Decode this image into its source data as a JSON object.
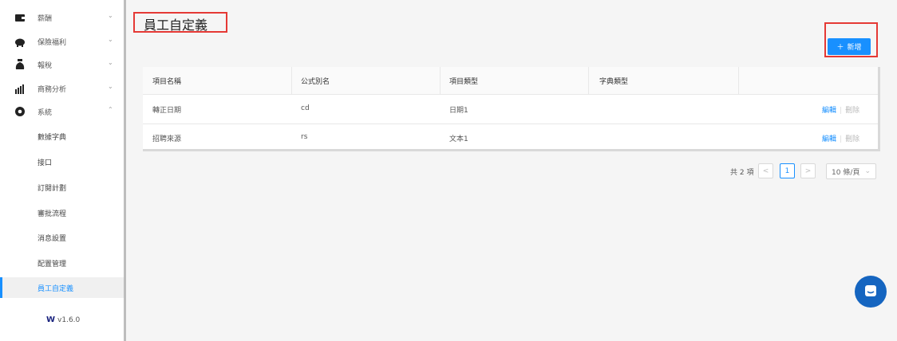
{
  "sidebar": {
    "items": [
      {
        "label": "薪酬",
        "icon": "wallet-icon",
        "chevron": "⌄"
      },
      {
        "label": "保險福利",
        "icon": "piggy-bank-icon",
        "chevron": "⌄"
      },
      {
        "label": "報稅",
        "icon": "money-bag-icon",
        "chevron": "⌄"
      },
      {
        "label": "商務分析",
        "icon": "bar-chart-icon",
        "chevron": "⌄"
      },
      {
        "label": "系統",
        "icon": "gear-icon",
        "chevron": "⌃"
      }
    ],
    "subitems": [
      {
        "label": "數據字典"
      },
      {
        "label": "接口"
      },
      {
        "label": "訂閱計劃"
      },
      {
        "label": "審批流程"
      },
      {
        "label": "消息設置"
      },
      {
        "label": "配置管理"
      },
      {
        "label": "員工自定義"
      }
    ],
    "version": "v1.6.0"
  },
  "page": {
    "title": "員工自定義",
    "add_button": "新增"
  },
  "table": {
    "headers": [
      "項目名稱",
      "公式別名",
      "項目類型",
      "字典類型"
    ],
    "rows": [
      {
        "name": "轉正日期",
        "alias": "cd",
        "type": "日期1",
        "dict": "",
        "edit": "編輯",
        "delete": "刪除"
      },
      {
        "name": "招聘來源",
        "alias": "rs",
        "type": "文本1",
        "dict": "",
        "edit": "編輯",
        "delete": "刪除"
      }
    ]
  },
  "pagination": {
    "total": "共 2 項",
    "prev": "<",
    "current": "1",
    "next": ">",
    "page_size": "10 條/頁"
  },
  "colors": {
    "accent": "#1890ff",
    "highlight_border": "#e53935",
    "chat": "#1565c0"
  }
}
